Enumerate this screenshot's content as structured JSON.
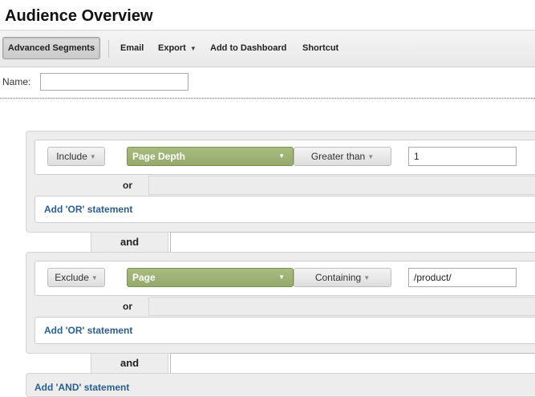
{
  "page": {
    "title": "Audience Overview"
  },
  "toolbar": {
    "advanced_segments": "Advanced Segments",
    "email": "Email",
    "export": "Export",
    "add_to_dashboard": "Add to Dashboard",
    "shortcut": "Shortcut"
  },
  "name_field": {
    "label": "Name:",
    "value": ""
  },
  "groups": [
    {
      "mode": "Include",
      "dimension": "Page Depth",
      "operator": "Greater than",
      "value": "1",
      "or_label": "or",
      "add_or": "Add 'OR' statement"
    },
    {
      "mode": "Exclude",
      "dimension": "Page",
      "operator": "Containing",
      "value": "/product/",
      "or_label": "or",
      "add_or": "Add 'OR' statement"
    }
  ],
  "connectors": {
    "and_1": "and",
    "and_2": "and"
  },
  "add_and": "Add 'AND' statement",
  "colors": {
    "dimension_green": "#9bb174",
    "link_blue": "#2b5e8f",
    "group_bg": "#ededed"
  },
  "icons": {
    "dropdown": "caret-down-icon"
  }
}
